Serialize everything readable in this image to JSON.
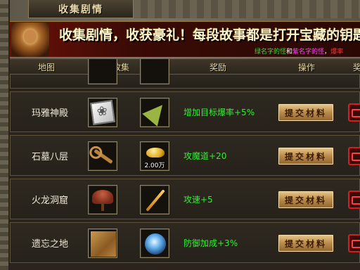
{
  "window": {
    "title": "收集剧情"
  },
  "banner": {
    "headline": "收集剧情，收获豪礼！每段故事都是打开宝藏的钥匙",
    "sub_green": "绿名字的怪",
    "sub_white1": "和",
    "sub_pink": "紫名字的怪",
    "sub_white2": "，",
    "sub_red": "爆率"
  },
  "table": {
    "headers": {
      "map": "地图",
      "collect": "收集",
      "reward": "奖励",
      "action": "操作",
      "extra": "奖"
    },
    "rows": [
      {
        "map": "玛雅神殿",
        "items": [
          {
            "icon": "mahjong-tile-icon",
            "count": ""
          },
          {
            "icon": "green-dart-icon",
            "count": ""
          }
        ],
        "reward": "增加目标爆率+5%",
        "button": "提交材料"
      },
      {
        "map": "石墓八层",
        "items": [
          {
            "icon": "bronze-key-icon",
            "count": ""
          },
          {
            "icon": "gold-ingot-icon",
            "count": "2.00万"
          }
        ],
        "reward": "攻魔道+20",
        "button": "提交材料"
      },
      {
        "map": "火龙洞窟",
        "items": [
          {
            "icon": "lingzhi-mushroom-icon",
            "count": ""
          },
          {
            "icon": "golden-stick-icon",
            "count": ""
          }
        ],
        "reward": "攻速+5",
        "button": "提交材料"
      },
      {
        "map": "遗忘之地",
        "items": [
          {
            "icon": "old-scroll-icon",
            "count": ""
          },
          {
            "icon": "blue-orb-icon",
            "count": ""
          }
        ],
        "reward": "防御加成+3%",
        "button": "提交材料"
      }
    ]
  },
  "colors": {
    "reward_text": "#33ee33",
    "header_text": "#e9d9a4",
    "button_gold": "#b98a4a",
    "banner_red": "#6b1208"
  }
}
